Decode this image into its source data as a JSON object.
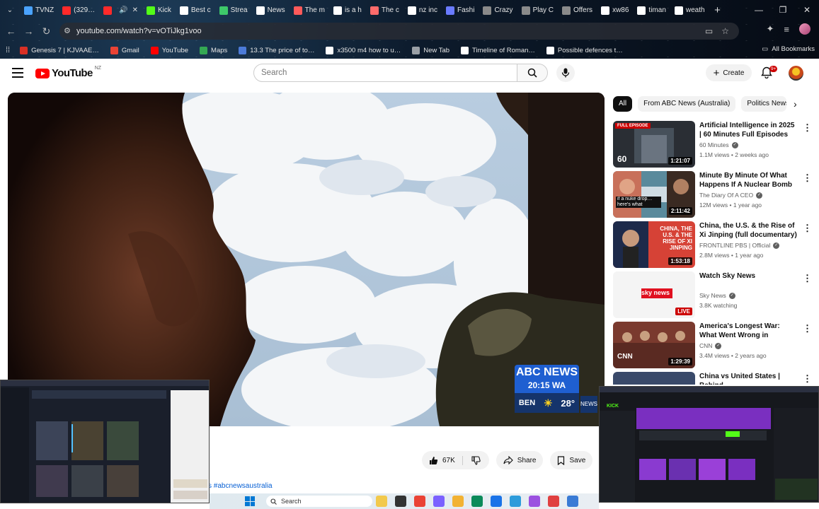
{
  "browser": {
    "tabs": [
      {
        "label": "TVNZ",
        "color": "#4aa3ff"
      },
      {
        "label": "(329…",
        "color": "#ff2a2a"
      },
      {
        "label": "",
        "color": "#ff2a2a"
      },
      {
        "label": "Kick",
        "color": "#53fc18"
      },
      {
        "label": "Best c",
        "color": "#ffffff"
      },
      {
        "label": "Strea",
        "color": "#3ec96a"
      },
      {
        "label": "News",
        "color": "#ffffff"
      },
      {
        "label": "The m",
        "color": "#ff5a5a"
      },
      {
        "label": "is a h",
        "color": "#ffffff"
      },
      {
        "label": "The c",
        "color": "#ff6b6b"
      },
      {
        "label": "nz inc",
        "color": "#ffffff"
      },
      {
        "label": "Fashi",
        "color": "#6a7bff"
      },
      {
        "label": "Crazy",
        "color": "#8a8a8a"
      },
      {
        "label": "Play C",
        "color": "#8a8a8a"
      },
      {
        "label": "Offers",
        "color": "#8a8a8a"
      },
      {
        "label": "xw86",
        "color": "#ffffff"
      },
      {
        "label": "timan",
        "color": "#ffffff"
      },
      {
        "label": "weath",
        "color": "#ffffff"
      }
    ],
    "url": "youtube.com/watch?v=vOTiJkg1voo",
    "bookmarks": [
      {
        "label": "Genesis 7 | KJVAAE…",
        "color": "#d93025"
      },
      {
        "label": "Gmail",
        "color": "#ea4335"
      },
      {
        "label": "YouTube",
        "color": "#ff0000"
      },
      {
        "label": "Maps",
        "color": "#34a853"
      },
      {
        "label": "13.3 The price of to…",
        "color": "#4c7bd9"
      },
      {
        "label": "x3500 m4 how to u…",
        "color": "#ffffff"
      },
      {
        "label": "New Tab",
        "color": "#9aa0a6"
      },
      {
        "label": "Timeline of Roman…",
        "color": "#ffffff"
      },
      {
        "label": "Possible defences t…",
        "color": "#ffffff"
      }
    ],
    "all_bookmarks": "All Bookmarks"
  },
  "youtube": {
    "logo_text": "YouTube",
    "region": "NZ",
    "search_placeholder": "Search",
    "create_label": "Create",
    "notification_badge": "9+"
  },
  "player": {
    "abc_brand": "ABC NEWS",
    "abc_time": "20:15 WA",
    "weather_city": "BEN",
    "weather_temp": "28°",
    "mini_logo": "NEWS"
  },
  "actions": {
    "likes": "67K",
    "share": "Share",
    "save": "Save"
  },
  "hashtag": "s #abcnewsaustralia",
  "chips": [
    "All",
    "From ABC News (Australia)",
    "Politics News"
  ],
  "recommendations": [
    {
      "title": "Artificial Intelligence in 2025 | 60 Minutes Full Episodes",
      "channel": "60 Minutes",
      "stats": "1.1M views • 2 weeks ago",
      "duration": "1:21:07",
      "tag": "FULL EPISODE"
    },
    {
      "title": "Minute By Minute Of What Happens If A Nuclear Bomb …",
      "channel": "The Diary Of A CEO",
      "stats": "12M views • 1 year ago",
      "duration": "2:11:42",
      "caption": "if a nuke drop… here's what happ…"
    },
    {
      "title": "China, the U.S. & the Rise of Xi Jinping (full documentary) | …",
      "channel": "FRONTLINE PBS | Official",
      "stats": "2.8M views • 1 year ago",
      "duration": "1:53:18",
      "caption": "CHINA, THE U.S. & THE RISE OF XI JINPING"
    },
    {
      "title": "Watch Sky News",
      "channel": "Sky News",
      "stats": "3.8K watching",
      "duration": "LIVE",
      "caption": "sky news"
    },
    {
      "title": "America's Longest War: What Went Wrong in Afghanistan …",
      "channel": "CNN",
      "stats": "3.4M views • 2 years ago",
      "duration": "1:29:39",
      "caption": "CNN"
    },
    {
      "title": "China vs United States | Behind",
      "channel": "",
      "stats": "",
      "duration": ""
    }
  ],
  "overlay_right_label": "KICK",
  "taskbar": {
    "search_label": "Search",
    "apps": [
      "#f2c94c",
      "#333333",
      "#ea4335",
      "#7b61ff",
      "#f2b233",
      "#0b8a5a",
      "#1a73e8",
      "#2d9cdb",
      "#9b51e0",
      "#e04040",
      "#3a7bd5"
    ]
  }
}
